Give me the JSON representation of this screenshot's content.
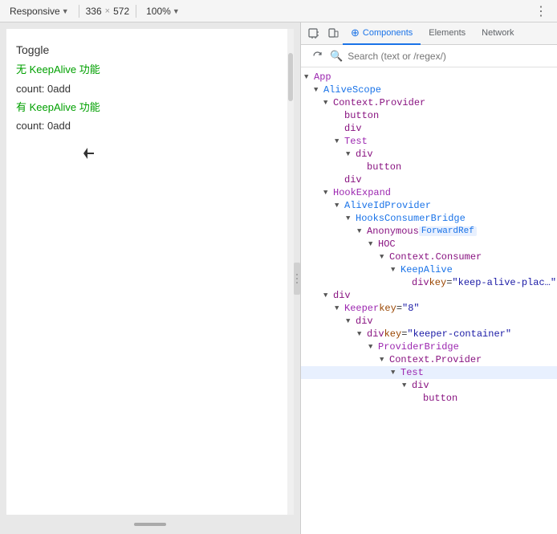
{
  "toolbar": {
    "device_label": "Responsive",
    "width": "336",
    "height": "572",
    "zoom": "100%",
    "more_icon": "⋮"
  },
  "preview": {
    "toggle_label": "Toggle",
    "no_keepalive_label": "无 KeepAlive 功能",
    "count_0_label": "count: 0add",
    "has_keepalive_label": "有 KeepAlive 功能",
    "count_1_label": "count: 0add"
  },
  "devtools": {
    "tabs": [
      {
        "label": "Components",
        "active": true,
        "icon": "⊕"
      },
      {
        "label": "Elements",
        "active": false
      },
      {
        "label": "Network",
        "active": false
      }
    ],
    "search_placeholder": "Search (text or /regex/)"
  },
  "tree": [
    {
      "indent": 0,
      "expand": "open",
      "name": "App",
      "type": "component",
      "color": "purple"
    },
    {
      "indent": 1,
      "expand": "open",
      "name": "AliveScope",
      "type": "component",
      "color": "blue"
    },
    {
      "indent": 2,
      "expand": "open",
      "name": "Context.Provider",
      "type": "component",
      "color": "default"
    },
    {
      "indent": 3,
      "expand": "leaf",
      "name": "button",
      "type": "tag"
    },
    {
      "indent": 3,
      "expand": "leaf",
      "name": "div",
      "type": "tag"
    },
    {
      "indent": 3,
      "expand": "open",
      "name": "Test",
      "type": "component",
      "color": "purple"
    },
    {
      "indent": 4,
      "expand": "open",
      "name": "div",
      "type": "tag"
    },
    {
      "indent": 5,
      "expand": "leaf",
      "name": "button",
      "type": "tag"
    },
    {
      "indent": 3,
      "expand": "leaf",
      "name": "div",
      "type": "tag"
    },
    {
      "indent": 2,
      "expand": "open",
      "name": "HookExpand",
      "type": "component",
      "color": "purple"
    },
    {
      "indent": 3,
      "expand": "open",
      "name": "AliveIdProvider",
      "type": "component",
      "color": "blue"
    },
    {
      "indent": 4,
      "expand": "open",
      "name": "HooksConsumerBridge",
      "type": "component",
      "color": "blue"
    },
    {
      "indent": 5,
      "expand": "open",
      "name": "Anonymous",
      "type": "component",
      "keyword": "ForwardRef",
      "color": "default"
    },
    {
      "indent": 6,
      "expand": "open",
      "name": "HOC",
      "type": "component",
      "color": "default"
    },
    {
      "indent": 7,
      "expand": "open",
      "name": "Context.Consumer",
      "type": "component",
      "color": "default"
    },
    {
      "indent": 8,
      "expand": "open",
      "name": "KeepAlive",
      "type": "component",
      "color": "blue"
    },
    {
      "indent": 9,
      "expand": "leaf",
      "name": "div",
      "type": "tag",
      "attr": "key",
      "attr_value": "\"keep-alive-plac…\""
    },
    {
      "indent": 2,
      "expand": "open",
      "name": "div",
      "type": "tag"
    },
    {
      "indent": 3,
      "expand": "open",
      "name": "Keeper",
      "type": "component",
      "attr": "key",
      "attr_value": "\"8\"",
      "color": "purple"
    },
    {
      "indent": 4,
      "expand": "open",
      "name": "div",
      "type": "tag"
    },
    {
      "indent": 5,
      "expand": "open",
      "name": "div",
      "type": "tag",
      "attr": "key",
      "attr_value": "\"keeper-container\""
    },
    {
      "indent": 6,
      "expand": "open",
      "name": "ProviderBridge",
      "type": "component",
      "color": "purple"
    },
    {
      "indent": 7,
      "expand": "open",
      "name": "Context.Provider",
      "type": "component",
      "color": "default"
    },
    {
      "indent": 8,
      "expand": "open",
      "name": "Test",
      "type": "component",
      "color": "purple",
      "selected": true
    },
    {
      "indent": 9,
      "expand": "open",
      "name": "div",
      "type": "tag"
    },
    {
      "indent": 10,
      "expand": "leaf",
      "name": "button",
      "type": "tag"
    }
  ]
}
